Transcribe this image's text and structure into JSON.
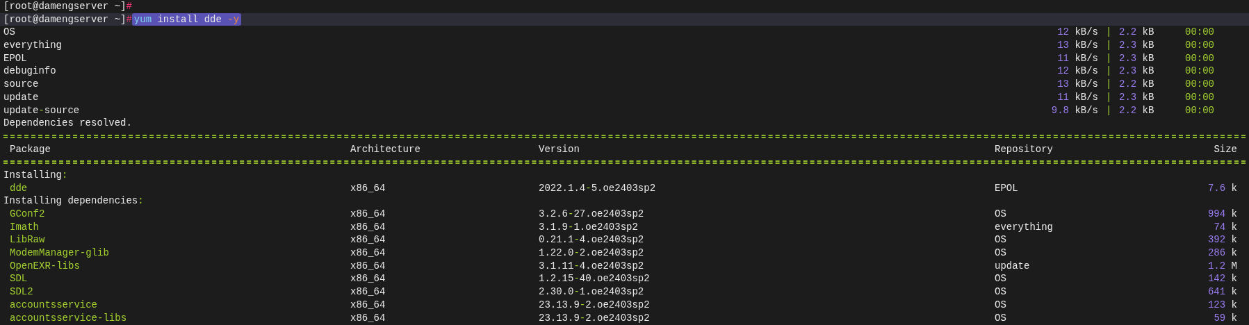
{
  "prompts": [
    {
      "prompt": "[root@damengserver ~]",
      "symbol": "#",
      "current": false
    },
    {
      "prompt": "[root@damengserver ~]",
      "symbol": "#",
      "command": [
        {
          "kind": "program",
          "text": "yum"
        },
        {
          "kind": "plain",
          "text": "install dde"
        },
        {
          "kind": "flag",
          "text": "-y"
        }
      ],
      "current": true
    }
  ],
  "repos": [
    {
      "name": "OS",
      "speed": "12 kB/s",
      "bar": "|",
      "size": "2.2 kB",
      "time": "00:00"
    },
    {
      "name": "everything",
      "speed": "13 kB/s",
      "bar": "|",
      "size": "2.3 kB",
      "time": "00:00"
    },
    {
      "name": "EPOL",
      "speed": "11 kB/s",
      "bar": "|",
      "size": "2.3 kB",
      "time": "00:00"
    },
    {
      "name": "debuginfo",
      "speed": "12 kB/s",
      "bar": "|",
      "size": "2.3 kB",
      "time": "00:00"
    },
    {
      "name": "source",
      "speed": "13 kB/s",
      "bar": "|",
      "size": "2.2 kB",
      "time": "00:00"
    },
    {
      "name": "update",
      "speed": "11 kB/s",
      "bar": "|",
      "size": "2.3 kB",
      "time": "00:00"
    },
    {
      "name": "update-source",
      "speed": "9.8 kB/s",
      "bar": "|",
      "size": "2.2 kB",
      "time": "00:00"
    }
  ],
  "status": "Dependencies resolved.",
  "table": {
    "columns": [
      "Package",
      "Architecture",
      "Version",
      "Repository",
      "Size"
    ],
    "groups": [
      {
        "title": "Installing:",
        "rows": [
          {
            "package": "dde",
            "arch": "x86_64",
            "version": "2022.1.4-5.oe2403sp2",
            "repository": "EPOL",
            "size": "7.6 k"
          }
        ]
      },
      {
        "title": "Installing dependencies:",
        "rows": [
          {
            "package": "GConf2",
            "arch": "x86_64",
            "version": "3.2.6-27.oe2403sp2",
            "repository": "OS",
            "size": "994 k"
          },
          {
            "package": "Imath",
            "arch": "x86_64",
            "version": "3.1.9-1.oe2403sp2",
            "repository": "everything",
            "size": "74 k"
          },
          {
            "package": "LibRaw",
            "arch": "x86_64",
            "version": "0.21.1-4.oe2403sp2",
            "repository": "OS",
            "size": "392 k"
          },
          {
            "package": "ModemManager-glib",
            "arch": "x86_64",
            "version": "1.22.0-2.oe2403sp2",
            "repository": "OS",
            "size": "286 k"
          },
          {
            "package": "OpenEXR-libs",
            "arch": "x86_64",
            "version": "3.1.11-4.oe2403sp2",
            "repository": "update",
            "size": "1.2 M"
          },
          {
            "package": "SDL",
            "arch": "x86_64",
            "version": "1.2.15-40.oe2403sp2",
            "repository": "OS",
            "size": "142 k"
          },
          {
            "package": "SDL2",
            "arch": "x86_64",
            "version": "2.30.0-1.oe2403sp2",
            "repository": "OS",
            "size": "641 k"
          },
          {
            "package": "accountsservice",
            "arch": "x86_64",
            "version": "23.13.9-2.oe2403sp2",
            "repository": "OS",
            "size": "123 k"
          },
          {
            "package": "accountsservice-libs",
            "arch": "x86_64",
            "version": "23.13.9-2.oe2403sp2",
            "repository": "OS",
            "size": "59 k"
          }
        ]
      }
    ]
  }
}
